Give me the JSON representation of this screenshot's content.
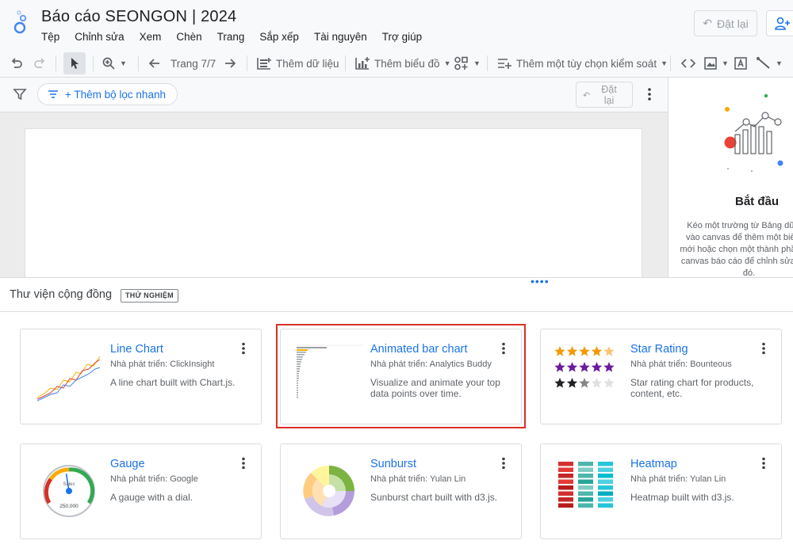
{
  "app": {
    "title": "Báo cáo SEONGON | 2024",
    "menu": [
      "Tệp",
      "Chỉnh sửa",
      "Xem",
      "Chèn",
      "Trang",
      "Sắp xếp",
      "Tài nguyên",
      "Trợ giúp"
    ],
    "reset_label": "Đặt lại"
  },
  "toolbar": {
    "page_label": "Trang 7/7",
    "add_data": "Thêm dữ liệu",
    "add_chart": "Thêm biểu đồ",
    "add_control": "Thêm một tùy chọn kiểm soát"
  },
  "filterbar": {
    "quick_filter": "+ Thêm bộ lọc nhanh",
    "reset_line1": "Đặt",
    "reset_line2": "lại"
  },
  "panel": {
    "title": "Bắt đầu",
    "description": "Kéo một trường từ Bảng dữ liệu vào canvas để thêm một biểu đồ mới hoặc chọn một thành phần trên canvas báo cáo để chỉnh sửa phần đó."
  },
  "library": {
    "title": "Thư viện cộng đồng",
    "badge": "THỬ NGHIỆM",
    "cards": [
      {
        "name": "Line Chart",
        "developer": "Nhà phát triển: ClickInsight",
        "description": "A line chart built with Chart.js."
      },
      {
        "name": "Animated bar chart",
        "developer": "Nhà phát triển: Analytics Buddy",
        "description": "Visualize and animate your top data points over time."
      },
      {
        "name": "Star Rating",
        "developer": "Nhà phát triển: Bounteous",
        "description": "Star rating chart for products, content, etc."
      },
      {
        "name": "Gauge",
        "developer": "Nhà phát triển: Google",
        "description": "A gauge with a dial."
      },
      {
        "name": "Sunburst",
        "developer": "Nhà phát triển: Yulan Lin",
        "description": "Sunburst chart built with d3.js."
      },
      {
        "name": "Heatmap",
        "developer": "Nhà phát triển: Yulan Lin",
        "description": "Heatmap built with d3.js."
      }
    ],
    "gauge_label": "Sales",
    "gauge_value": "250,000",
    "gauge_level": 0.45,
    "star_rows": [
      4.5,
      5,
      2.5
    ]
  },
  "colors": {
    "accent": "#1a73e8",
    "highlight": "#d93025",
    "star_orange": "#f29900",
    "star_purple": "#6a1b9a"
  }
}
